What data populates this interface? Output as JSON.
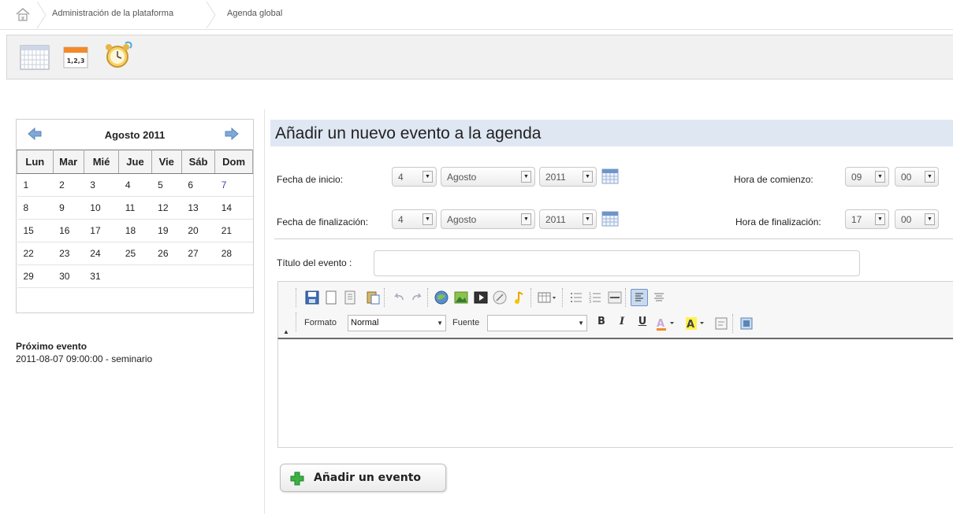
{
  "breadcrumb": {
    "items": [
      "Administración de la plataforma",
      "Agenda global"
    ]
  },
  "toolbar": {
    "icons": [
      "month-calendar-icon",
      "numbered-calendar-icon",
      "alarm-clock-icon"
    ]
  },
  "calendar": {
    "title": "Agosto 2011",
    "weekdays": [
      "Lun",
      "Mar",
      "Mié",
      "Jue",
      "Vie",
      "Sáb",
      "Dom"
    ],
    "weeks": [
      [
        "1",
        "2",
        "3",
        "4",
        "5",
        "6",
        "7"
      ],
      [
        "8",
        "9",
        "10",
        "11",
        "12",
        "13",
        "14"
      ],
      [
        "15",
        "16",
        "17",
        "18",
        "19",
        "20",
        "21"
      ],
      [
        "22",
        "23",
        "24",
        "25",
        "26",
        "27",
        "28"
      ],
      [
        "29",
        "30",
        "31",
        "",
        "",
        "",
        ""
      ]
    ]
  },
  "next_event": {
    "label": "Próximo evento",
    "text": "2011-08-07 09:00:00 - seminario"
  },
  "form": {
    "title": "Añadir un nuevo evento a la agenda",
    "start": {
      "label": "Fecha de inicio:",
      "day": "4",
      "month": "Agosto",
      "year": "2011",
      "time_label": "Hora de comienzo:",
      "hour": "09",
      "minute": "00"
    },
    "end": {
      "label": "Fecha de finalización:",
      "day": "4",
      "month": "Agosto",
      "year": "2011",
      "time_label": "Hora de finalización:",
      "hour": "17",
      "minute": "00"
    },
    "event_title_label": "Título del evento :",
    "event_title_value": "",
    "editor": {
      "format_label": "Formato",
      "format_value": "Normal",
      "font_label": "Fuente",
      "font_value": ""
    },
    "submit_label": "Añadir un evento"
  },
  "colors": {
    "title_bar": "#dfe7f3",
    "sunday": "#3344aa",
    "plus_green": "#3cb043"
  }
}
